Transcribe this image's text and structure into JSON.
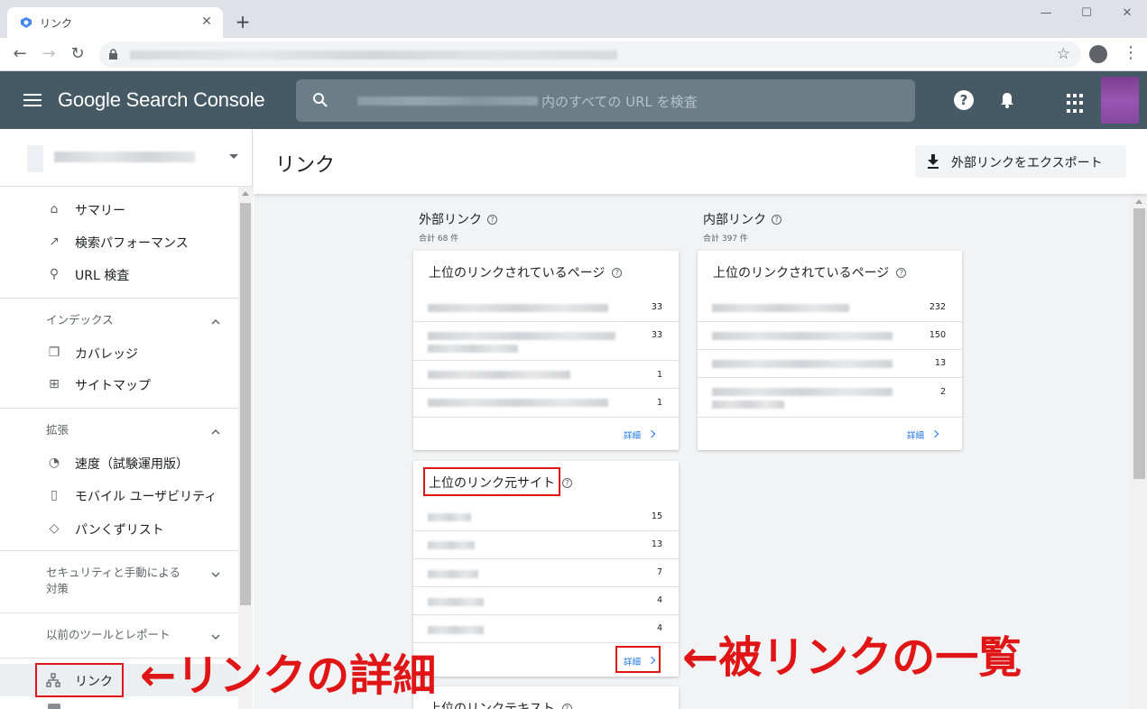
{
  "browser": {
    "tab_title": "リンク",
    "new_tab": "+",
    "win_min": "—",
    "win_max": "☐",
    "win_close": "✕",
    "back": "←",
    "forward": "→",
    "reload": "↻",
    "star": "☆",
    "menu": "⋮"
  },
  "header": {
    "brand": "Google Search Console",
    "search_placeholder": "内のすべての URL を検査",
    "help": "?"
  },
  "sidebar": {
    "items_top": [
      {
        "icon": "⌂",
        "label": "サマリー"
      },
      {
        "icon": "↗",
        "label": "検索パフォーマンス"
      },
      {
        "icon": "⚲",
        "label": "URL 検査"
      }
    ],
    "section_index": "インデックス",
    "items_index": [
      {
        "icon": "❐",
        "label": "カバレッジ"
      },
      {
        "icon": "⊞",
        "label": "サイトマップ"
      }
    ],
    "section_ext": "拡張",
    "items_ext": [
      {
        "icon": "◔",
        "label": "速度（試験運用版）"
      },
      {
        "icon": "▯",
        "label": "モバイル ユーザビリティ"
      },
      {
        "icon": "◇",
        "label": "パンくずリスト"
      }
    ],
    "section_security_1": "セキュリティと手動による",
    "section_security_2": "対策",
    "section_legacy": "以前のツールとレポート",
    "links_label": "リンク"
  },
  "main": {
    "page_title": "リンク",
    "export_label": "外部リンクをエクスポート",
    "external": {
      "title": "外部リンク",
      "total": "合計 68 件",
      "top_linked_title": "上位のリンクされているページ",
      "top_linked_values": [
        "33",
        "33",
        "1",
        "1"
      ],
      "top_sites_title": "上位のリンク元サイト",
      "top_sites_values": [
        "15",
        "13",
        "7",
        "4",
        "4"
      ],
      "link_text_title": "上位のリンクテキスト"
    },
    "internal": {
      "title": "内部リンク",
      "total": "合計 397 件",
      "top_linked_title": "上位のリンクされているページ",
      "top_linked_values": [
        "232",
        "150",
        "13",
        "2"
      ]
    },
    "details_label": "詳細",
    "qmark": "?"
  },
  "annotations": {
    "left": "←リンクの詳細",
    "right": "←被リンクの一覧",
    "color": "#e01515"
  }
}
